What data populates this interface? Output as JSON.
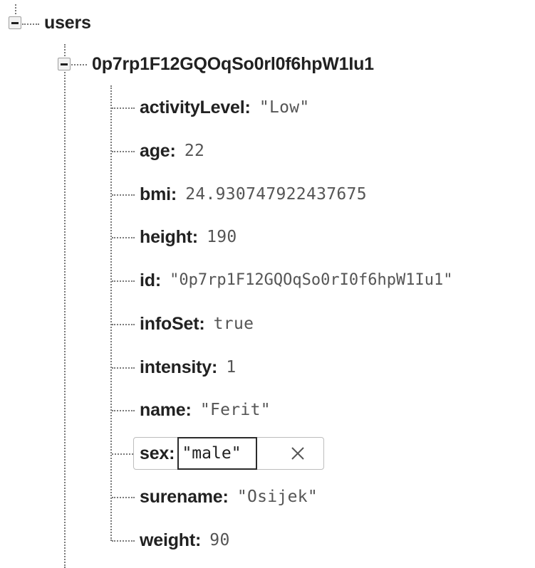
{
  "root": {
    "label": "users",
    "child": {
      "label": "0p7rp1F12GQOqSo0rl0f6hpW1Iu1",
      "fields": [
        {
          "key": "activityLevel",
          "value": "\"Low\""
        },
        {
          "key": "age",
          "value": "22"
        },
        {
          "key": "bmi",
          "value": "24.930747922437675"
        },
        {
          "key": "height",
          "value": "190"
        },
        {
          "key": "id",
          "value": "\"0p7rp1F12GQOqSo0rI0f6hpW1Iu1\""
        },
        {
          "key": "infoSet",
          "value": "true"
        },
        {
          "key": "intensity",
          "value": "1"
        },
        {
          "key": "name",
          "value": "\"Ferit\""
        }
      ],
      "editing": {
        "key": "sex",
        "value": "\"male\"",
        "close_icon": "close-icon"
      },
      "fields_after": [
        {
          "key": "surename",
          "value": "\"Osijek\""
        },
        {
          "key": "weight",
          "value": "90"
        }
      ]
    }
  },
  "colors": {
    "key_text": "#212121",
    "value_text": "#555555",
    "connector": "#7a7a7a"
  }
}
